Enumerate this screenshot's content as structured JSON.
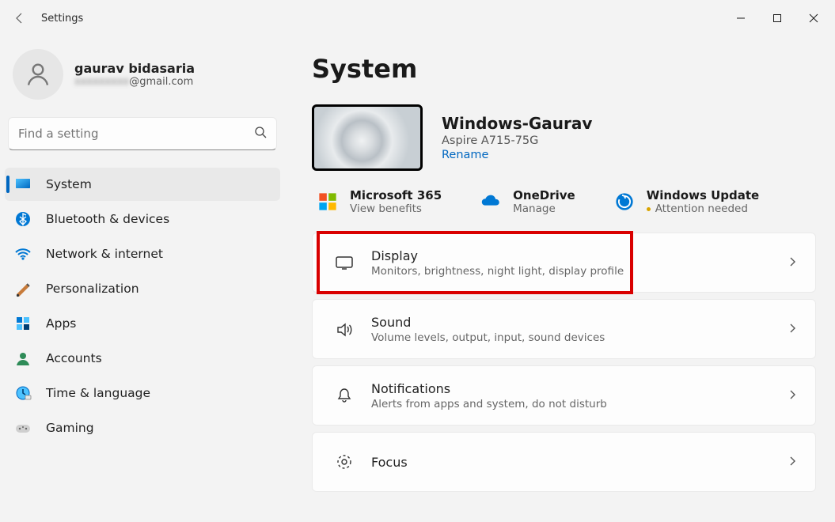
{
  "app": {
    "title": "Settings"
  },
  "account": {
    "name": "gaurav bidasaria",
    "email_suffix": "@gmail.com"
  },
  "search": {
    "placeholder": "Find a setting"
  },
  "nav": [
    {
      "label": "System",
      "icon": "system",
      "selected": true
    },
    {
      "label": "Bluetooth & devices",
      "icon": "bluetooth"
    },
    {
      "label": "Network & internet",
      "icon": "wifi"
    },
    {
      "label": "Personalization",
      "icon": "personalization"
    },
    {
      "label": "Apps",
      "icon": "apps"
    },
    {
      "label": "Accounts",
      "icon": "accounts"
    },
    {
      "label": "Time & language",
      "icon": "time"
    },
    {
      "label": "Gaming",
      "icon": "gaming"
    }
  ],
  "page": {
    "title": "System"
  },
  "device": {
    "name": "Windows-Gaurav",
    "model": "Aspire A715-75G",
    "rename": "Rename"
  },
  "quicklinks": [
    {
      "title": "Microsoft 365",
      "sub": "View benefits",
      "icon": "ms365"
    },
    {
      "title": "OneDrive",
      "sub": "Manage",
      "icon": "onedrive"
    },
    {
      "title": "Windows Update",
      "sub": "Attention needed",
      "icon": "update",
      "warn": true
    }
  ],
  "cards": [
    {
      "title": "Display",
      "sub": "Monitors, brightness, night light, display profile",
      "icon": "display",
      "highlight": true
    },
    {
      "title": "Sound",
      "sub": "Volume levels, output, input, sound devices",
      "icon": "sound"
    },
    {
      "title": "Notifications",
      "sub": "Alerts from apps and system, do not disturb",
      "icon": "notifications"
    },
    {
      "title": "Focus",
      "sub": "",
      "icon": "focus"
    }
  ]
}
